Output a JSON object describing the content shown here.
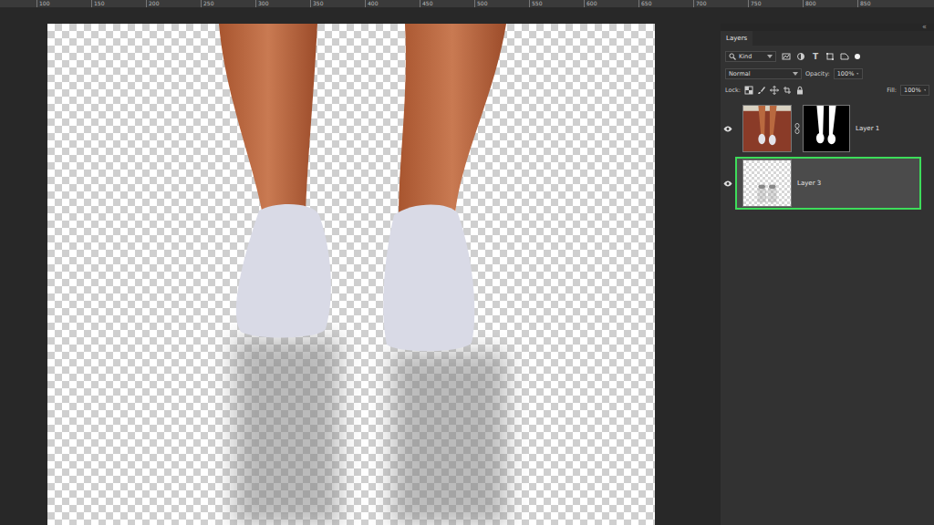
{
  "ruler": {
    "labels": [
      "100",
      "150",
      "200",
      "250",
      "300",
      "350",
      "400",
      "450",
      "500",
      "550",
      "600",
      "650",
      "700",
      "750",
      "800",
      "850"
    ]
  },
  "panel": {
    "collapse_glyph": "«",
    "tabs": [
      {
        "label": "Layers",
        "selected": true
      }
    ]
  },
  "filter": {
    "kind": "Kind",
    "type_glyph": "T",
    "filter_on": true
  },
  "blend": {
    "mode": "Normal",
    "opacity_label": "Opacity:",
    "opacity_value": "100%"
  },
  "lock": {
    "label": "Lock:",
    "fill_label": "Fill:",
    "fill_value": "100%"
  },
  "layers": [
    {
      "name": "Layer 1",
      "kind": "masked",
      "visible": true,
      "selected": false,
      "highlighted": false
    },
    {
      "name": "Layer 3",
      "kind": "plain",
      "visible": true,
      "selected": true,
      "highlighted": true
    }
  ]
}
